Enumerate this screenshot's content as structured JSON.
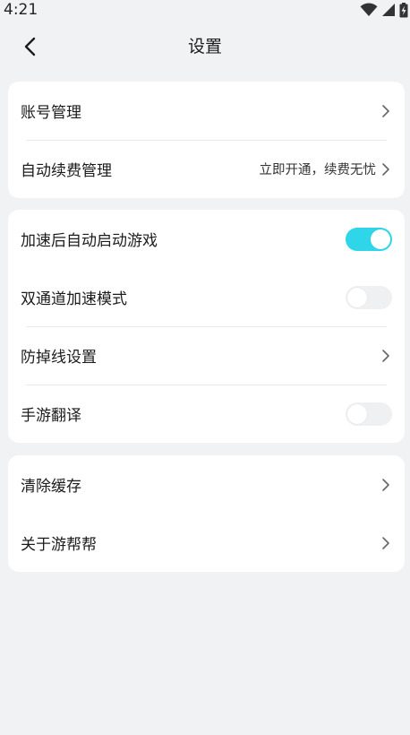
{
  "status_bar": {
    "time": "4:21"
  },
  "header": {
    "title": "设置",
    "back_icon": "chevron-left-icon"
  },
  "groups": {
    "account": {
      "items": [
        {
          "label": "账号管理"
        },
        {
          "label": "自动续费管理",
          "value": "立即开通，续费无忧"
        }
      ]
    },
    "acceleration": {
      "items": [
        {
          "label": "加速后自动启动游戏",
          "toggle": true
        },
        {
          "label": "双通道加速模式",
          "toggle": false
        },
        {
          "label": "防掉线设置"
        },
        {
          "label": "手游翻译",
          "toggle": false
        }
      ]
    },
    "misc": {
      "items": [
        {
          "label": "清除缓存"
        },
        {
          "label": "关于游帮帮"
        }
      ]
    }
  },
  "colors": {
    "background": "#f0f2f4",
    "card": "#ffffff",
    "toggle_on": "#2fd6ea",
    "toggle_off": "#eef0f2"
  }
}
